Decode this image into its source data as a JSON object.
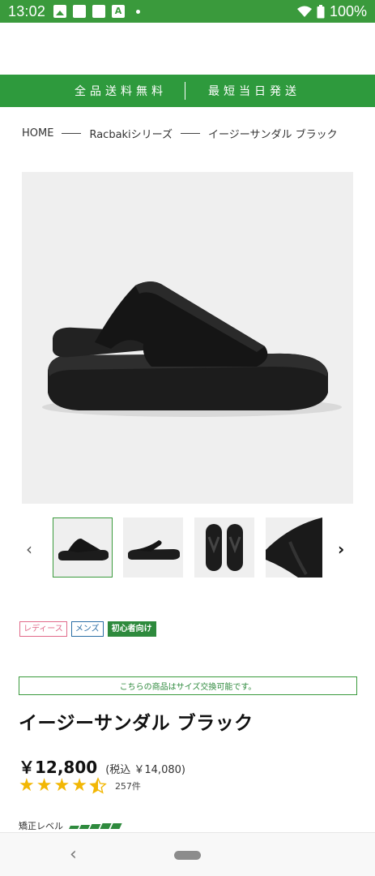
{
  "status_bar": {
    "time": "13:02",
    "battery": "100%",
    "icons": [
      "image-icon",
      "square-icon",
      "square-icon",
      "translate-icon",
      "dot-icon",
      "wifi-icon",
      "battery-icon"
    ]
  },
  "banner": {
    "left": "全品送料無料",
    "right": "最短当日発送"
  },
  "breadcrumb": {
    "items": [
      "HOME",
      "Racbakiシリーズ",
      "イージーサンダル ブラック"
    ]
  },
  "tags": [
    "レディース",
    "メンズ",
    "初心者向け"
  ],
  "notice": "こちらの商品はサイズ交換可能です。",
  "product": {
    "title": "イージーサンダル ブラック",
    "price": "￥12,800",
    "price_tax": "(税込 ￥14,080)",
    "rating": 4.5,
    "review_count": "257件",
    "level_label": "矯正レベル",
    "level": 5
  },
  "colors": {
    "brand_green": "#2e9a3d",
    "star": "#f2b705",
    "ladies": "#e06a8a",
    "mens": "#2b6ea5"
  }
}
